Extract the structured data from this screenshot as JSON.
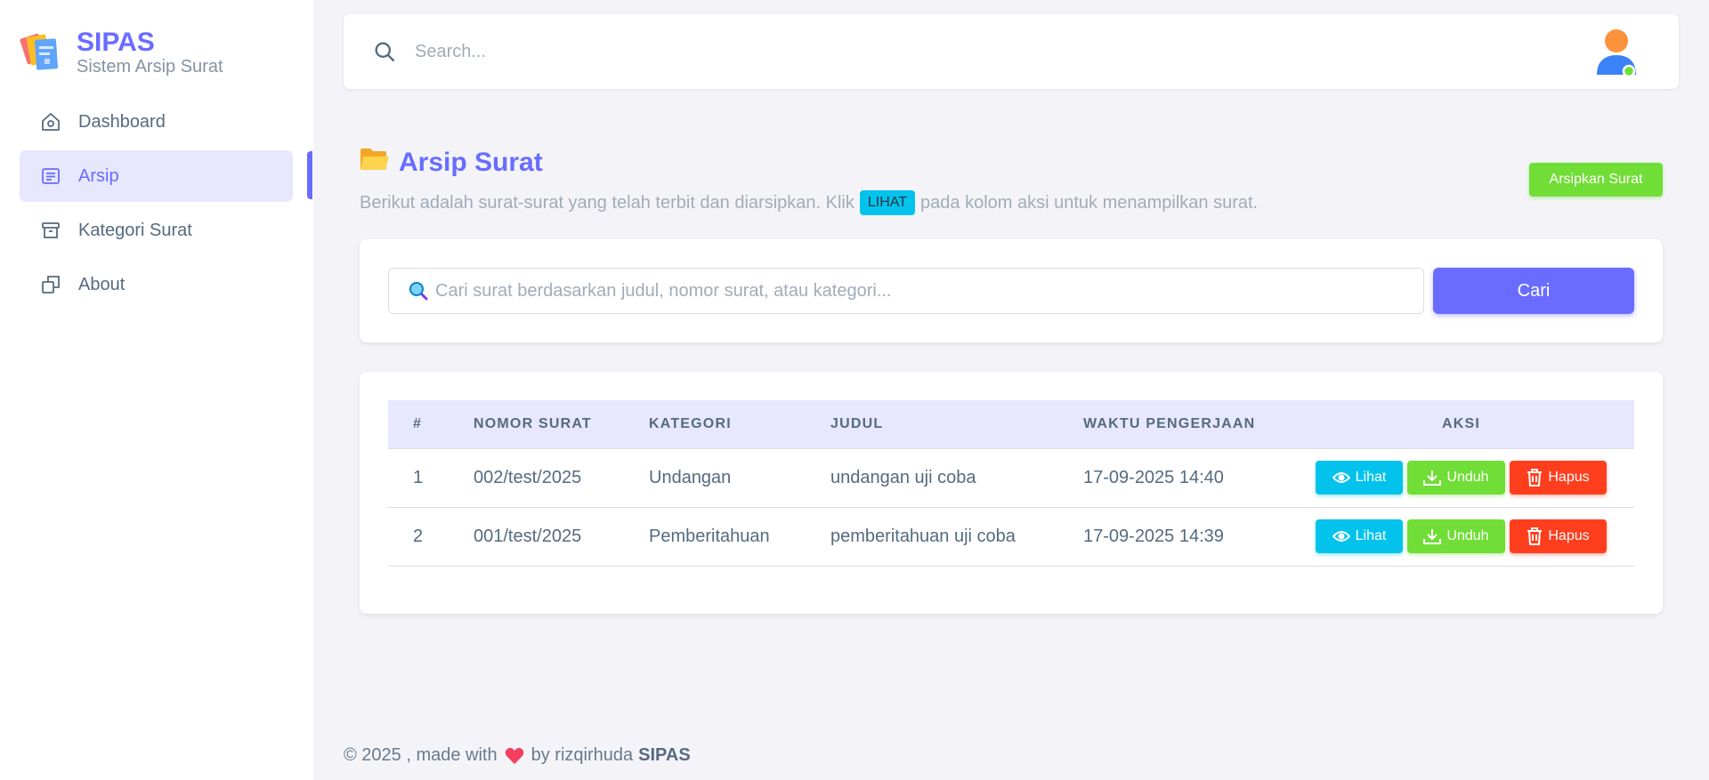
{
  "brand": {
    "name": "SIPAS",
    "subtitle": "Sistem Arsip Surat"
  },
  "sidebar": {
    "items": [
      {
        "label": "Dashboard",
        "icon": "home-icon",
        "active": false
      },
      {
        "label": "Arsip",
        "icon": "document-icon",
        "active": true
      },
      {
        "label": "Kategori Surat",
        "icon": "archive-box-icon",
        "active": false
      },
      {
        "label": "About",
        "icon": "copy-icon",
        "active": false
      }
    ]
  },
  "topbar": {
    "search_placeholder": "Search..."
  },
  "header": {
    "title": "Arsip Surat",
    "desc_before": "Berikut adalah surat-surat yang telah terbit dan diarsipkan. Klik",
    "desc_badge": "LIHAT",
    "desc_after": "pada kolom aksi untuk menampilkan surat.",
    "arsipkan_label": "Arsipkan Surat"
  },
  "filter": {
    "placeholder": "Cari surat berdasarkan judul, nomor surat, atau kategori...",
    "button_label": "Cari"
  },
  "table": {
    "headers": [
      "#",
      "NOMOR SURAT",
      "KATEGORI",
      "JUDUL",
      "WAKTU PENGERJAAN",
      "AKSI"
    ],
    "rows": [
      {
        "no": "1",
        "nomor": "002/test/2025",
        "kategori": "Undangan",
        "judul": "undangan uji coba",
        "waktu": "17-09-2025 14:40"
      },
      {
        "no": "2",
        "nomor": "001/test/2025",
        "kategori": "Pemberitahuan",
        "judul": "pemberitahuan uji coba",
        "waktu": "17-09-2025 14:39"
      }
    ],
    "actions": {
      "lihat": "Lihat",
      "unduh": "Unduh",
      "hapus": "Hapus"
    }
  },
  "footer": {
    "before": "© 2025 , made with",
    "by": "by rizqirhuda",
    "brand": "SIPAS"
  },
  "colors": {
    "primary": "#696cff",
    "info": "#03c3ec",
    "success": "#71dd37",
    "danger": "#ff3e1d"
  }
}
